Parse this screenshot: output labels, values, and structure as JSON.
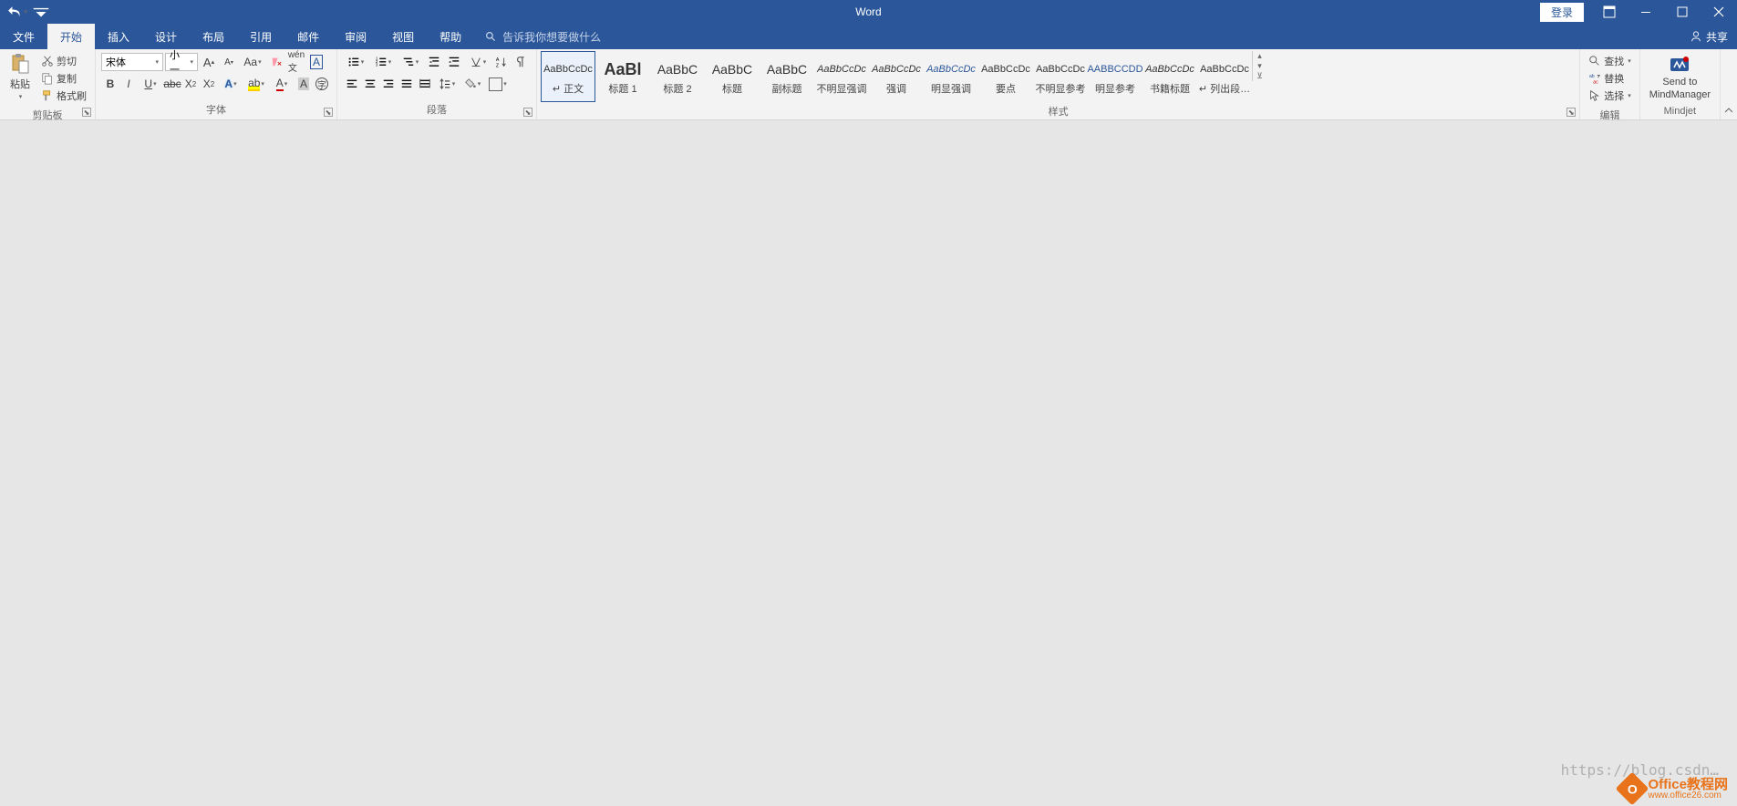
{
  "app_title": "Word",
  "titlebar": {
    "login": "登录"
  },
  "tabs": {
    "file": "文件",
    "home": "开始",
    "insert": "插入",
    "design": "设计",
    "layout": "布局",
    "references": "引用",
    "mailings": "邮件",
    "review": "审阅",
    "view": "视图",
    "help": "帮助",
    "tellme_placeholder": "告诉我你想要做什么",
    "share": "共享"
  },
  "clipboard": {
    "paste": "粘贴",
    "cut": "剪切",
    "copy": "复制",
    "format_painter": "格式刷",
    "label": "剪贴板"
  },
  "font": {
    "name": "宋体",
    "size": "小一",
    "label": "字体"
  },
  "paragraph": {
    "label": "段落"
  },
  "styles": {
    "label": "样式",
    "items": [
      {
        "preview": "AaBbCcDc",
        "name": "↵ 正文",
        "cls": ""
      },
      {
        "preview": "AaBl",
        "name": "标题 1",
        "cls": "big"
      },
      {
        "preview": "AaBbC",
        "name": "标题 2",
        "cls": ""
      },
      {
        "preview": "AaBbC",
        "name": "标题",
        "cls": ""
      },
      {
        "preview": "AaBbC",
        "name": "副标题",
        "cls": ""
      },
      {
        "preview": "AaBbCcDc",
        "name": "不明显强调",
        "cls": "italic"
      },
      {
        "preview": "AaBbCcDc",
        "name": "强调",
        "cls": "italic"
      },
      {
        "preview": "AaBbCcDc",
        "name": "明显强调",
        "cls": "italic blue"
      },
      {
        "preview": "AaBbCcDc",
        "name": "要点",
        "cls": ""
      },
      {
        "preview": "AaBbCcDc",
        "name": "不明显参考",
        "cls": ""
      },
      {
        "preview": "AABBCCDD",
        "name": "明显参考",
        "cls": "caps blue"
      },
      {
        "preview": "AaBbCcDc",
        "name": "书籍标题",
        "cls": "italic"
      },
      {
        "preview": "AaBbCcDc",
        "name": "↵ 列出段…",
        "cls": ""
      }
    ]
  },
  "editing": {
    "find": "查找",
    "replace": "替换",
    "select": "选择",
    "label": "编辑"
  },
  "mindjet": {
    "line1": "Send to",
    "line2": "MindManager",
    "label": "Mindjet"
  },
  "watermark": {
    "url": "https://blog.csdn…",
    "brand": "Office教程网",
    "site": "www.office26.com"
  }
}
